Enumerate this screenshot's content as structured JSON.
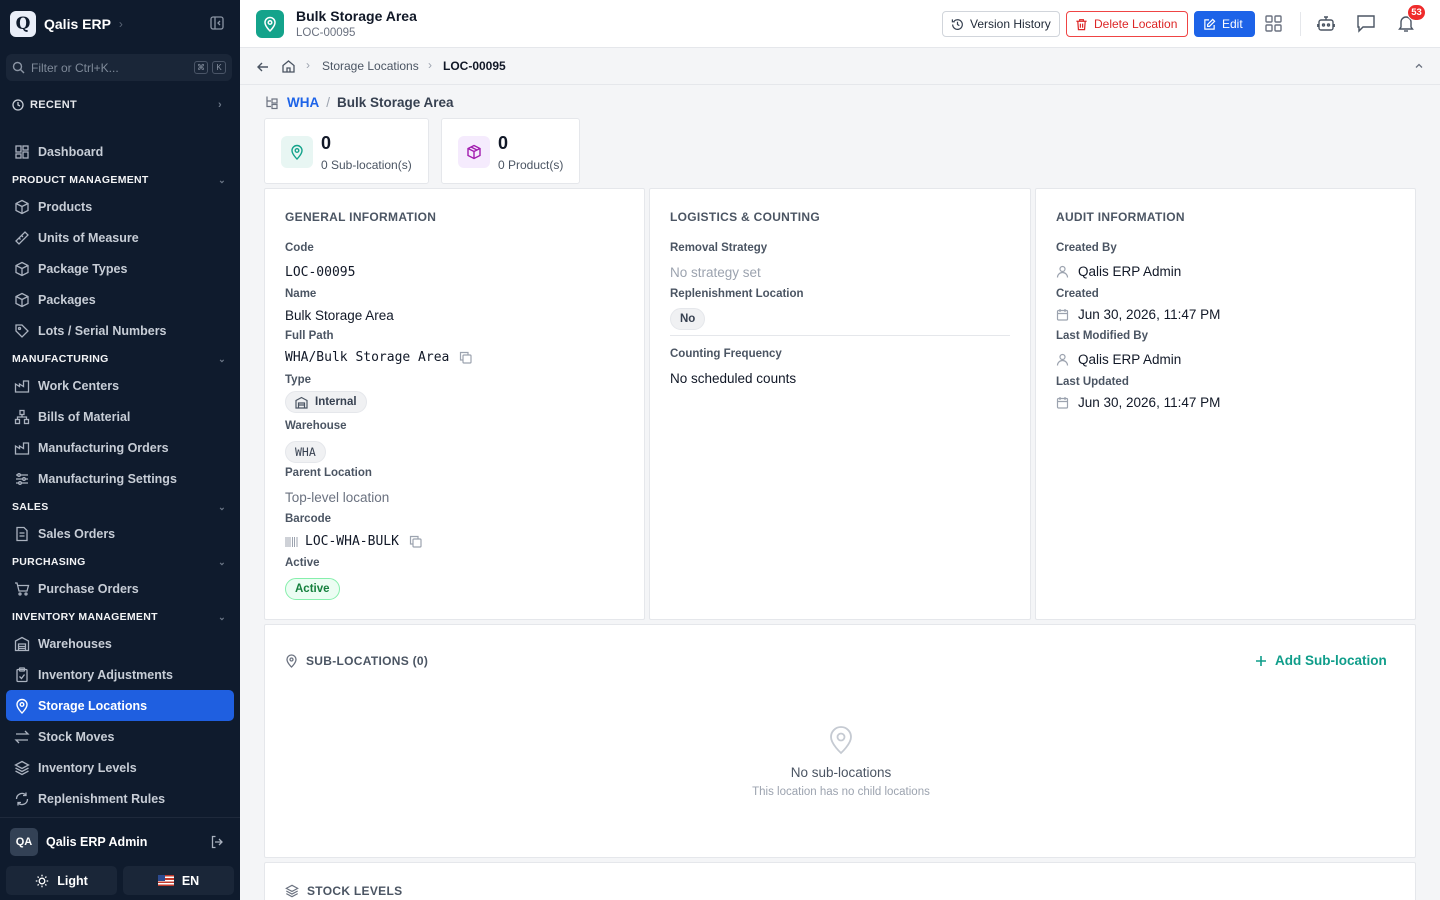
{
  "app": {
    "name": "Qalis ERP",
    "logo_letter": "Q"
  },
  "sidebar": {
    "filter_placeholder": "Filter or Ctrl+K...",
    "kbd1": "⌘",
    "kbd2": "K",
    "recent_label": "RECENT",
    "dashboard": "Dashboard",
    "sections": {
      "product": "PRODUCT MANAGEMENT",
      "manufacturing": "MANUFACTURING",
      "sales": "SALES",
      "purchasing": "PURCHASING",
      "inventory": "INVENTORY MANAGEMENT"
    },
    "items": {
      "products": "Products",
      "uom": "Units of Measure",
      "package_types": "Package Types",
      "packages": "Packages",
      "lots": "Lots / Serial Numbers",
      "work_centers": "Work Centers",
      "bom": "Bills of Material",
      "mo": "Manufacturing Orders",
      "mfg_settings": "Manufacturing Settings",
      "sales_orders": "Sales Orders",
      "purchase_orders": "Purchase Orders",
      "warehouses": "Warehouses",
      "inv_adjust": "Inventory Adjustments",
      "storage_locations": "Storage Locations",
      "stock_moves": "Stock Moves",
      "inv_levels": "Inventory Levels",
      "replenishment": "Replenishment Rules"
    },
    "user": {
      "initials": "QA",
      "name": "Qalis ERP Admin"
    },
    "theme_label": "Light",
    "lang_label": "EN"
  },
  "header": {
    "title": "Bulk Storage Area",
    "subtitle": "LOC-00095",
    "version_history": "Version History",
    "delete_location": "Delete Location",
    "edit": "Edit",
    "notif_count": "53"
  },
  "breadcrumb": {
    "parent": "Storage Locations",
    "current": "LOC-00095"
  },
  "path": {
    "warehouse": "WHA",
    "sep": "/",
    "current": "Bulk Storage Area"
  },
  "stats": {
    "sub_count": "0",
    "sub_label": "0 Sub-location(s)",
    "prod_count": "0",
    "prod_label": "0 Product(s)"
  },
  "general": {
    "title": "GENERAL INFORMATION",
    "code_label": "Code",
    "code": "LOC-00095",
    "name_label": "Name",
    "name": "Bulk Storage Area",
    "full_path_label": "Full Path",
    "full_path": "WHA/Bulk Storage Area",
    "type_label": "Type",
    "type": "Internal",
    "warehouse_label": "Warehouse",
    "warehouse": "WHA",
    "parent_label": "Parent Location",
    "parent": "Top-level location",
    "barcode_label": "Barcode",
    "barcode": "LOC-WHA-BULK",
    "active_label": "Active",
    "active": "Active"
  },
  "logistics": {
    "title": "LOGISTICS & COUNTING",
    "removal_label": "Removal Strategy",
    "removal": "No strategy set",
    "replenish_label": "Replenishment Location",
    "replenish": "No",
    "counting_label": "Counting Frequency",
    "counting": "No scheduled counts"
  },
  "audit": {
    "title": "AUDIT INFORMATION",
    "created_by_label": "Created By",
    "created_by": "Qalis ERP Admin",
    "created_label": "Created",
    "created": "Jun 30, 2026, 11:47 PM",
    "modified_by_label": "Last Modified By",
    "modified_by": "Qalis ERP Admin",
    "updated_label": "Last Updated",
    "updated": "Jun 30, 2026, 11:47 PM"
  },
  "sublocations": {
    "title": "SUB-LOCATIONS (0)",
    "add": "Add Sub-location",
    "empty_title": "No sub-locations",
    "empty_desc": "This location has no child locations"
  },
  "stock": {
    "title": "STOCK LEVELS"
  },
  "colors": {
    "accent": "#1d63e8",
    "teal": "#14a38b",
    "danger": "#dc2626",
    "sidebar_bg": "#0f1b2d"
  }
}
